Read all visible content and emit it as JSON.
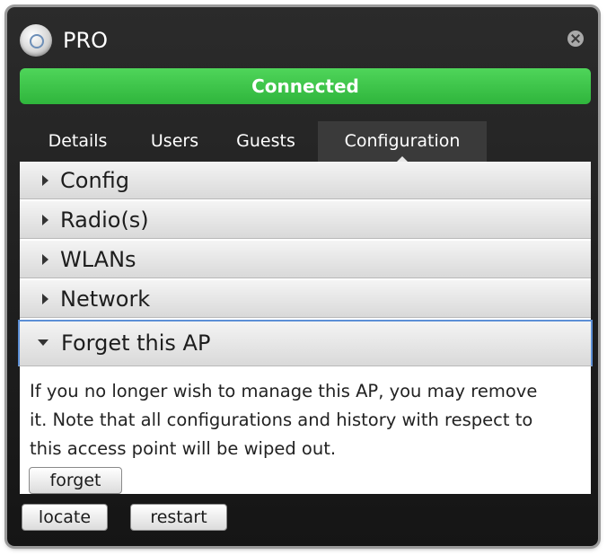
{
  "window": {
    "title": "PRO",
    "icons": {
      "app": "access-point-icon",
      "close": "close-icon"
    }
  },
  "status": {
    "label": "Connected",
    "color": "#3cc24a"
  },
  "tabs": [
    {
      "label": "Details",
      "active": false
    },
    {
      "label": "Users",
      "active": false
    },
    {
      "label": "Guests",
      "active": false
    },
    {
      "label": "Configuration",
      "active": true
    }
  ],
  "sections": [
    {
      "label": "Config",
      "expanded": false
    },
    {
      "label": "Radio(s)",
      "expanded": false
    },
    {
      "label": "WLANs",
      "expanded": false
    },
    {
      "label": "Network",
      "expanded": false
    },
    {
      "label": "Forget this AP",
      "expanded": true
    }
  ],
  "forget_panel": {
    "description_line1": "If you no longer wish to manage this AP, you may remove",
    "description_line2": "it. Note that all configurations and history with respect to",
    "description_line3": "this access point will be wiped out.",
    "forget_button": "forget"
  },
  "footer": {
    "locate_button": "locate",
    "restart_button": "restart"
  }
}
